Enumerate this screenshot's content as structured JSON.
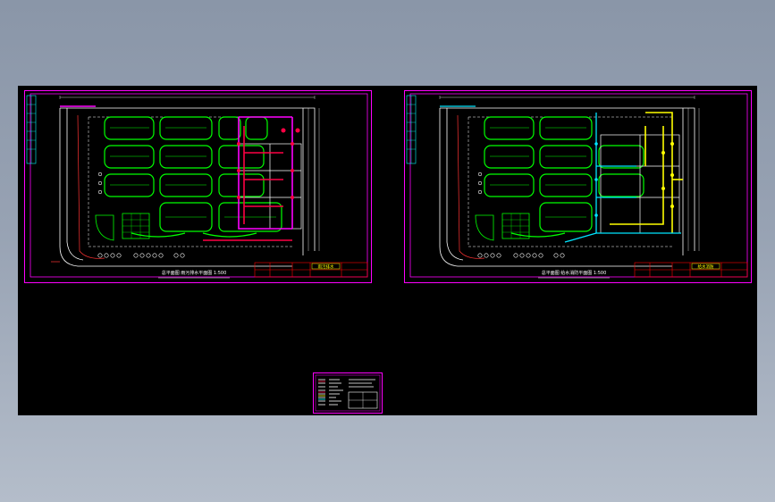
{
  "app": {
    "title": "",
    "accent_color": "#ff00ff",
    "background_color": "#000000",
    "layer_colors": {
      "frame": "#ff00ff",
      "roads": "#00ff00",
      "walls": "#ffffff",
      "drain_pipe": "#ff0044",
      "water_pipe": "#ffff00",
      "gas_pipe": "#00ffff",
      "title_block": "#ff0000"
    }
  },
  "drawings": [
    {
      "id": "left",
      "caption": "总平面图  雨污排水平面图  1:500",
      "stamp": "雨污排水",
      "pipe_color": "#ff00ff",
      "pipe_secondary_color": "#ff2255"
    },
    {
      "id": "right",
      "caption": "总平面图  给水消防平面图  1:500",
      "stamp": "给水消防",
      "pipe_color": "#ffff00",
      "pipe_secondary_color": "#00e5ff"
    }
  ],
  "legend_sheet": {
    "title": "图例",
    "icon": "legend-table-icon"
  }
}
